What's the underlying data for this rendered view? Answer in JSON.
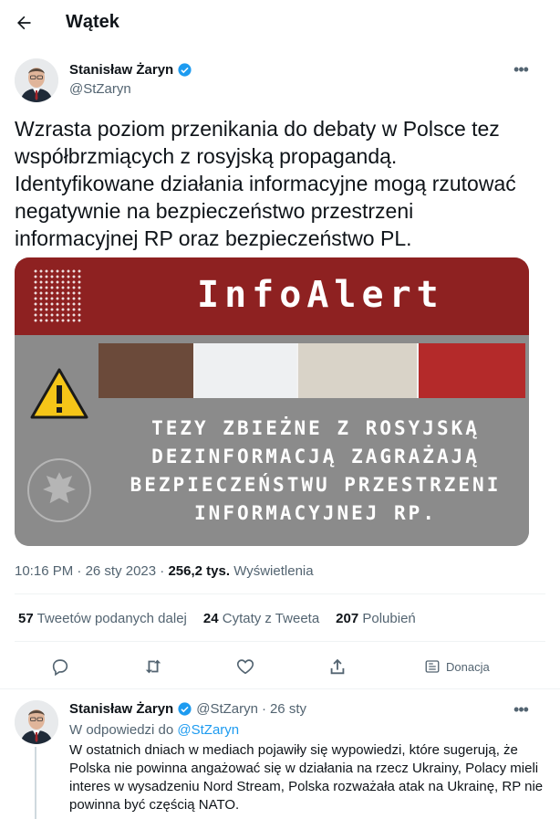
{
  "header": {
    "title": "Wątek"
  },
  "tweet": {
    "author_name": "Stanisław Żaryn",
    "author_handle": "@StZaryn",
    "text": "Wzrasta poziom przenikania do debaty w Polsce tez współbrzmiących z rosyjską propagandą. Identyfikowane działania informacyjne mogą rzutować negatywnie na bezpieczeństwo przestrzeni informacyjnej RP oraz bezpieczeństwo PL.",
    "media": {
      "title": "InfoAlert",
      "caption": "TEZY ZBIEŻNE Z ROSYJSKĄ DEZINFORMACJĄ ZAGRAŻAJĄ BEZPIECZEŃSTWU PRZESTRZENI INFORMACYJNEJ RP."
    },
    "time": "10:16 PM",
    "date": "26 sty 2023",
    "views_count": "256,2 tys.",
    "views_label": "Wyświetlenia",
    "stats": {
      "retweets_count": "57",
      "retweets_label": "Tweetów podanych dalej",
      "quotes_count": "24",
      "quotes_label": "Cytaty z Tweeta",
      "likes_count": "207",
      "likes_label": "Polubień"
    },
    "actions": {
      "donate_label": "Donacja"
    }
  },
  "reply": {
    "author_name": "Stanisław Żaryn",
    "author_handle": "@StZaryn",
    "separator": "·",
    "date": "26 sty",
    "reply_to_label": "W odpowiedzi do",
    "reply_to_handle": "@StZaryn",
    "text": "W ostatnich dniach w mediach pojawiły się wypowiedzi, które sugerują, że Polska nie powinna angażować się w działania na rzecz Ukrainy, Polacy mieli interes w wysadzeniu Nord Stream, Polska rozważała atak na Ukrainę, RP nie powinna być częścią NATO."
  },
  "colors": {
    "accent": "#1d9bf0",
    "secondary_text": "#536471",
    "banner_red": "#8e2121"
  }
}
